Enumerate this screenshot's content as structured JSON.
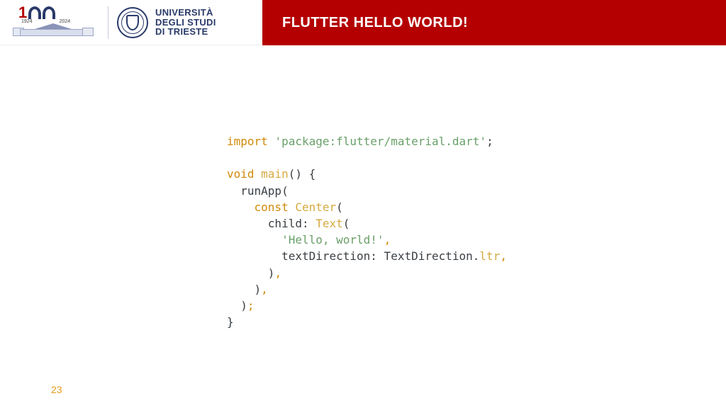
{
  "header": {
    "title": "FLUTTER HELLO WORLD!",
    "university": {
      "line1": "UNIVERSITÀ",
      "line2": "DEGLI STUDI",
      "line3": "DI TRIESTE"
    },
    "centennial": {
      "year_start": "1924",
      "year_end": "2024"
    }
  },
  "code": {
    "tokens": [
      [
        {
          "t": "import ",
          "c": "kw"
        },
        {
          "t": "'package:flutter/material.dart'",
          "c": "str"
        },
        {
          "t": ";",
          "c": "txt"
        }
      ],
      [],
      [
        {
          "t": "void ",
          "c": "kw"
        },
        {
          "t": "main",
          "c": "fn"
        },
        {
          "t": "() {",
          "c": "txt"
        }
      ],
      [
        {
          "t": "  runApp(",
          "c": "txt"
        }
      ],
      [
        {
          "t": "    ",
          "c": "txt"
        },
        {
          "t": "const ",
          "c": "kw"
        },
        {
          "t": "Center",
          "c": "fn"
        },
        {
          "t": "(",
          "c": "txt"
        }
      ],
      [
        {
          "t": "      child: ",
          "c": "txt"
        },
        {
          "t": "Text",
          "c": "fn"
        },
        {
          "t": "(",
          "c": "txt"
        }
      ],
      [
        {
          "t": "        ",
          "c": "txt"
        },
        {
          "t": "'Hello, world!'",
          "c": "str"
        },
        {
          "t": ",",
          "c": "pun"
        }
      ],
      [
        {
          "t": "        textDirection: TextDirection.",
          "c": "txt"
        },
        {
          "t": "ltr",
          "c": "fn"
        },
        {
          "t": ",",
          "c": "pun"
        }
      ],
      [
        {
          "t": "      )",
          "c": "txt"
        },
        {
          "t": ",",
          "c": "pun"
        }
      ],
      [
        {
          "t": "    )",
          "c": "txt"
        },
        {
          "t": ",",
          "c": "pun"
        }
      ],
      [
        {
          "t": "  )",
          "c": "txt"
        },
        {
          "t": ";",
          "c": "pun"
        }
      ],
      [
        {
          "t": "}",
          "c": "txt"
        }
      ]
    ]
  },
  "page_number": "23"
}
